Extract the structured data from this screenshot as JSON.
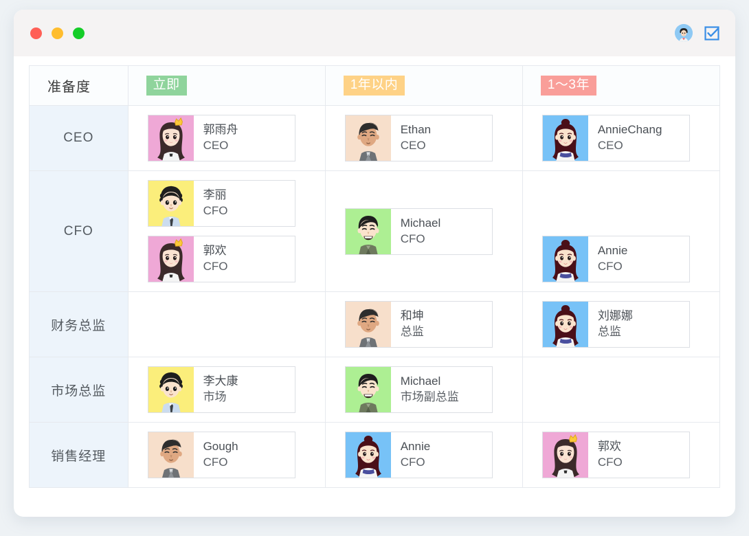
{
  "window": {
    "traffic_lights": [
      "close",
      "minimize",
      "maximize"
    ],
    "icons": [
      {
        "name": "user-avatar-icon",
        "label": "avatar"
      },
      {
        "name": "checkbox-icon",
        "label": "check"
      }
    ]
  },
  "table": {
    "header": {
      "label": "准备度",
      "tags": [
        {
          "text": "立即",
          "color": "#8fd49c",
          "style": "green"
        },
        {
          "text": "1年以内",
          "color": "#fed286",
          "style": "orange"
        },
        {
          "text": "1～3年",
          "color": "#f99e99",
          "style": "red"
        }
      ]
    },
    "rows": [
      {
        "label": "CEO",
        "columns": [
          [
            {
              "name": "郭雨舟",
              "role": "CEO",
              "avatar": "woman-crown-pink"
            }
          ],
          [
            {
              "name": "Ethan",
              "role": "CEO",
              "avatar": "man-quiff-peach"
            }
          ],
          [
            {
              "name": "AnnieChang",
              "role": "CEO",
              "avatar": "girl-bun-blue"
            }
          ]
        ]
      },
      {
        "label": "CFO",
        "columns": [
          [
            {
              "name": "李丽",
              "role": "CFO",
              "avatar": "man-curly-yellow"
            },
            {
              "name": "郭欢",
              "role": "CFO",
              "avatar": "woman-crown-pink"
            }
          ],
          [
            {
              "name": "Michael",
              "role": "CFO",
              "avatar": "man-grin-green"
            }
          ],
          [
            {
              "name": "",
              "role": "",
              "avatar": "blank"
            },
            {
              "name": "Annie",
              "role": "CFO",
              "avatar": "girl-bun-blue"
            }
          ]
        ]
      },
      {
        "label": "财务总监",
        "columns": [
          [],
          [
            {
              "name": "和坤",
              "role": "总监",
              "avatar": "man-quiff-peach"
            }
          ],
          [
            {
              "name": "刘娜娜",
              "role": "总监",
              "avatar": "girl-bun-blue"
            }
          ]
        ]
      },
      {
        "label": "市场总监",
        "columns": [
          [
            {
              "name": "李大康",
              "role": "市场",
              "avatar": "man-curly-yellow"
            }
          ],
          [
            {
              "name": "Michael",
              "role": "市场副总监",
              "avatar": "man-grin-green"
            }
          ],
          []
        ]
      },
      {
        "label": "销售经理",
        "columns": [
          [
            {
              "name": "Gough",
              "role": "CFO",
              "avatar": "man-quiff-peach"
            }
          ],
          [
            {
              "name": "Annie",
              "role": "CFO",
              "avatar": "girl-bun-blue"
            }
          ],
          [
            {
              "name": "郭欢",
              "role": "CFO",
              "avatar": "woman-crown-pink"
            }
          ]
        ]
      }
    ]
  }
}
